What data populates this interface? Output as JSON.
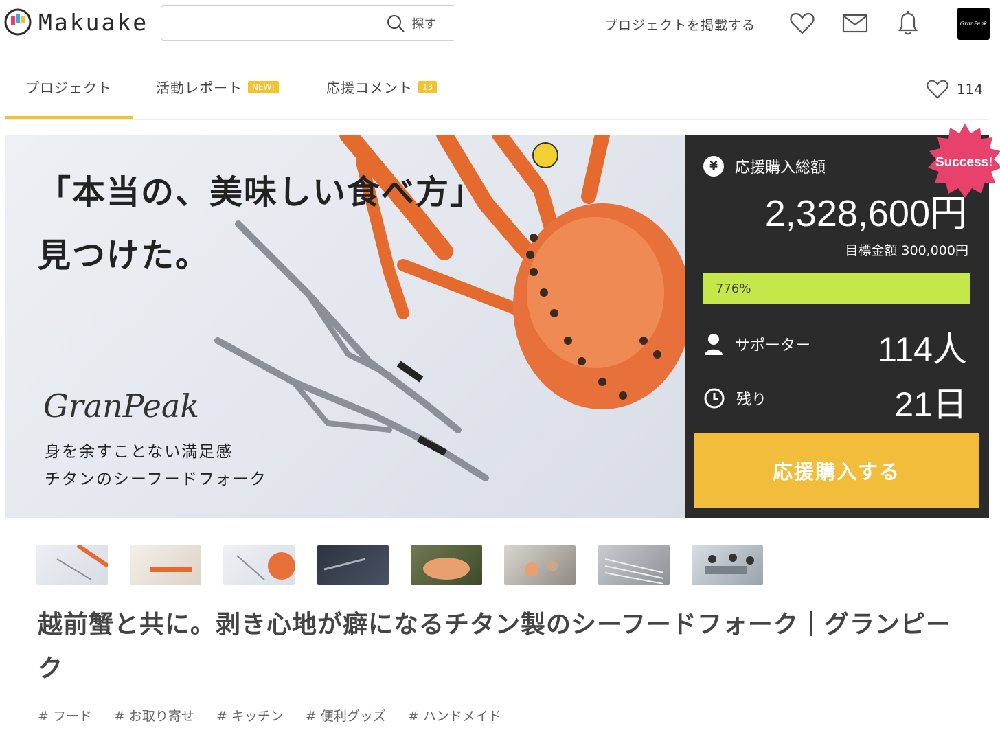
{
  "header": {
    "logo_text": "Makuake",
    "search_placeholder": "",
    "search_button_label": "探す",
    "post_project_label": "プロジェクトを掲載する"
  },
  "tabs": [
    {
      "label": "プロジェクト",
      "badge": ""
    },
    {
      "label": "活動レポート",
      "badge": "NEW!"
    },
    {
      "label": "応援コメント",
      "badge": "13"
    }
  ],
  "favorite_count": "114",
  "hero": {
    "headline_line1": "「本当の、美味しい食べ方」",
    "headline_line2": "見つけた。",
    "brand": "GranPeak",
    "sub_line1": "身を余すことない満足感",
    "sub_line2": "チタンのシーフードフォーク"
  },
  "funding": {
    "label": "応援購入総額",
    "total": "2,328,600円",
    "goal": "目標金額 300,000円",
    "progress_label": "776%",
    "progress_percent": 776,
    "supporters_label": "サポーター",
    "supporters_value": "114人",
    "remaining_label": "残り",
    "remaining_value": "21日",
    "buy_button": "応援購入する",
    "status_badge": "Success!"
  },
  "colors": {
    "accent": "#f2c230",
    "panel_bg": "#2b2b2b",
    "progress": "#c6e74a",
    "success_badge": "#e8416b"
  },
  "thumbnails_count": 8,
  "project_title": "越前蟹と共に。剥き心地が癖になるチタン製のシーフードフォーク｜グランピーク",
  "tags": [
    "# フード",
    "# お取り寄せ",
    "# キッチン",
    "# 便利グッズ",
    "# ハンドメイド"
  ]
}
